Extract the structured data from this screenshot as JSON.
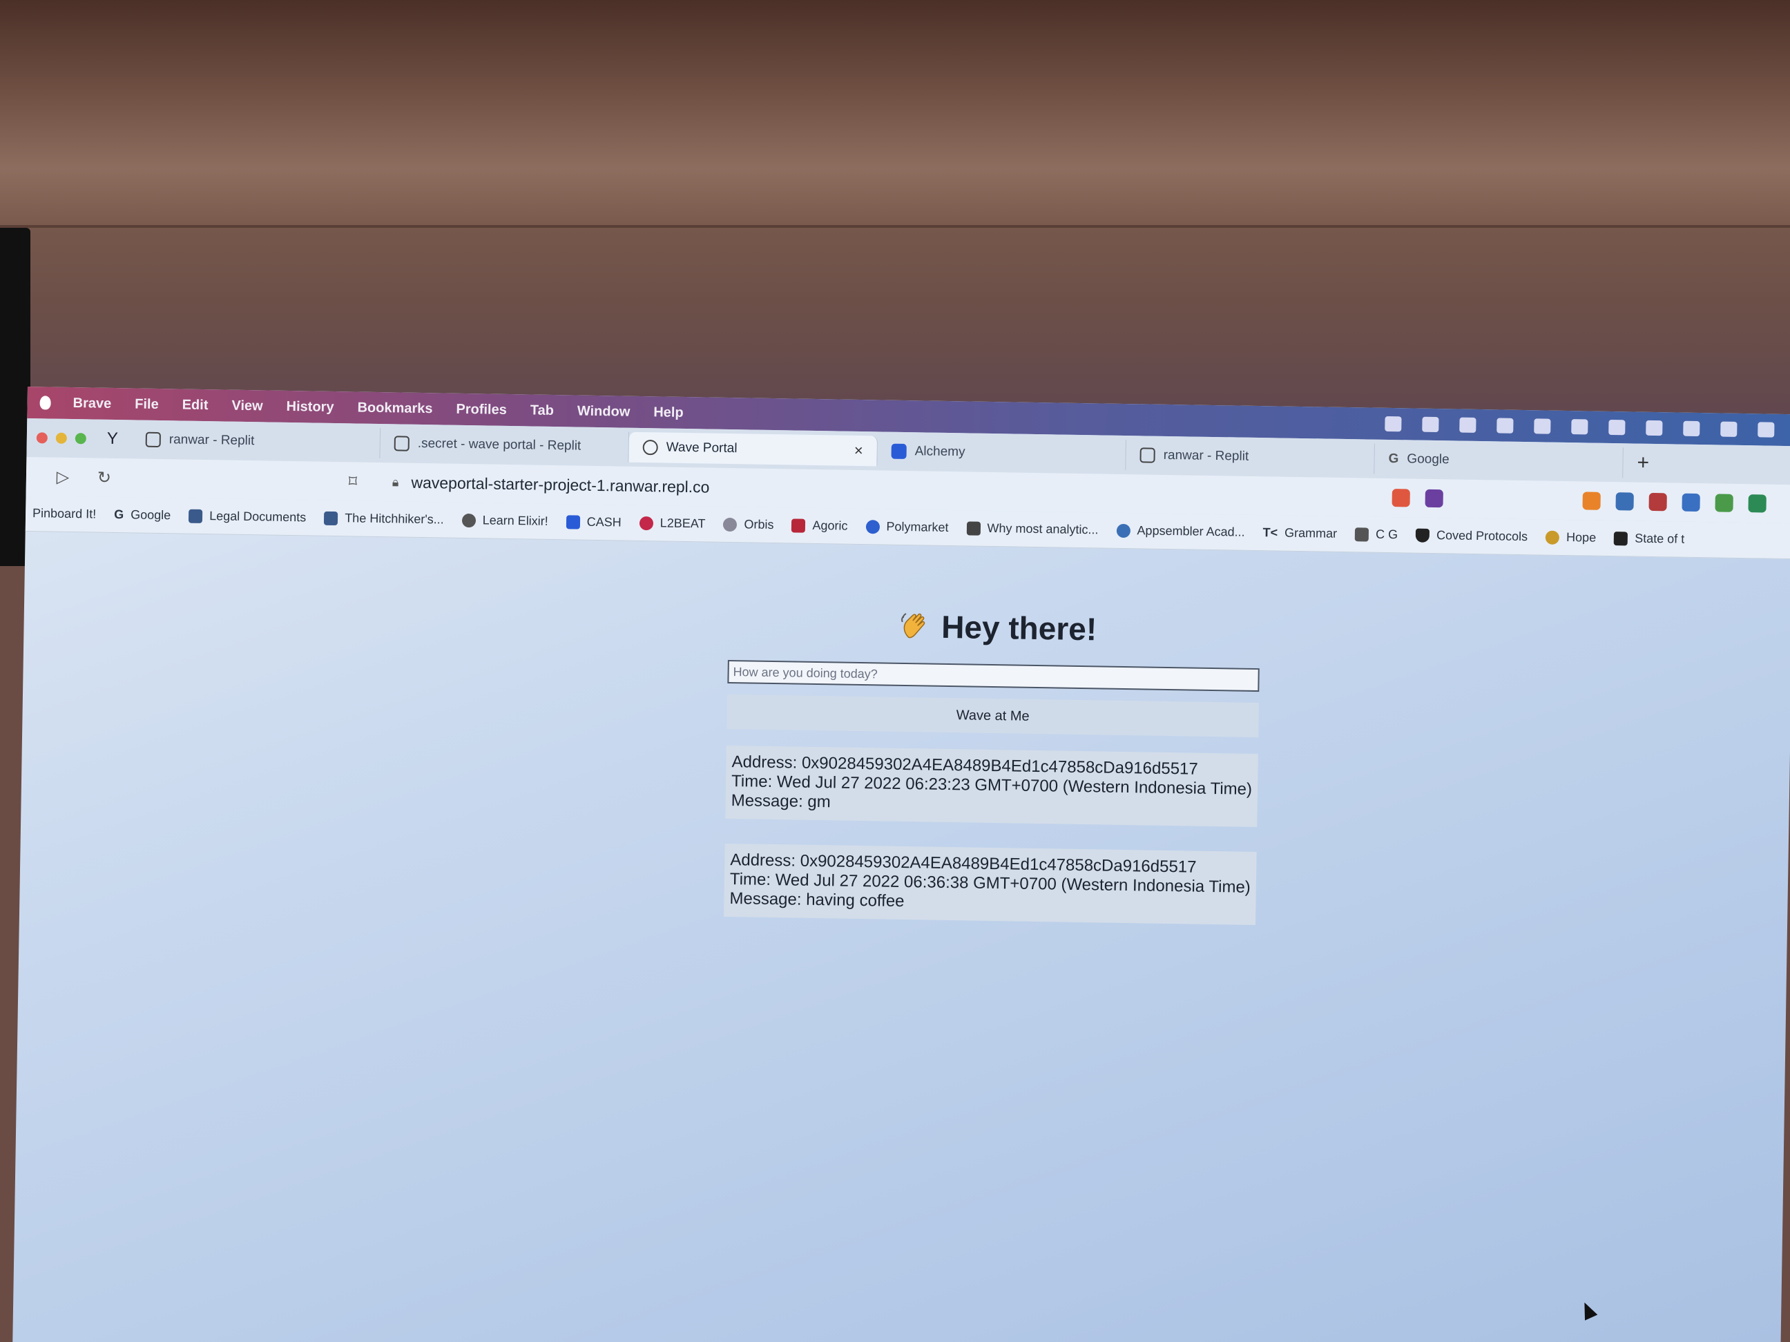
{
  "menubar": {
    "items": [
      "Brave",
      "File",
      "Edit",
      "View",
      "History",
      "Bookmarks",
      "Profiles",
      "Tab",
      "Window",
      "Help"
    ]
  },
  "tabs": [
    {
      "title": "ranwar - Replit"
    },
    {
      "title": ".secret - wave portal - Replit"
    },
    {
      "title": "Wave Portal"
    },
    {
      "title": "Alchemy"
    },
    {
      "title": "ranwar - Replit"
    },
    {
      "title": "Google"
    }
  ],
  "toolbar": {
    "url": "waveportal-starter-project-1.ranwar.repl.co"
  },
  "bookmarks": [
    "Pinboard It!",
    "Google",
    "Legal Documents",
    "The Hitchhiker's...",
    "Learn Elixir!",
    "CASH",
    "L2BEAT",
    "Orbis",
    "Agoric",
    "Polymarket",
    "Why most analytic...",
    "Appsembler Acad...",
    "Grammar",
    "C G",
    "Coved Protocols",
    "Hope",
    "State of t"
  ],
  "page": {
    "heading": "Hey there!",
    "input_placeholder": "How are you doing today?",
    "wave_button": "Wave at Me",
    "waves": [
      {
        "address": "Address: 0x9028459302A4EA8489B4Ed1c47858cDa916d5517",
        "time": "Time: Wed Jul 27 2022 06:23:23 GMT+0700 (Western Indonesia Time)",
        "message": "Message: gm"
      },
      {
        "address": "Address: 0x9028459302A4EA8489B4Ed1c47858cDa916d5517",
        "time": "Time: Wed Jul 27 2022 06:36:38 GMT+0700 (Western Indonesia Time)",
        "message": "Message: having coffee"
      }
    ]
  },
  "colors": {
    "menubar_start": "#a8466a",
    "menubar_end": "#3d63a8",
    "page_bg": "#c8d8ee",
    "card_bg": "#d3dde9"
  }
}
